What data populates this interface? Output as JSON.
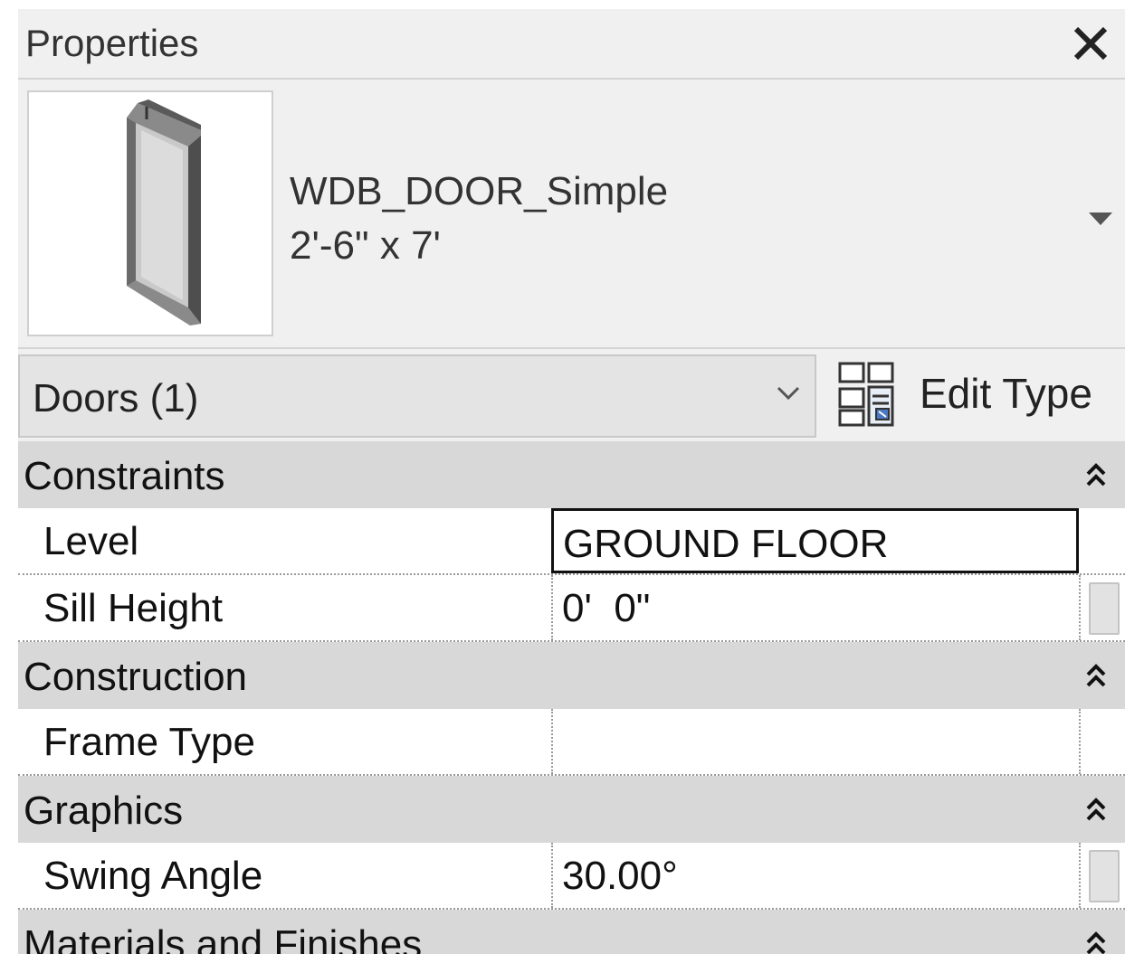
{
  "window": {
    "title": "Properties"
  },
  "type_selector": {
    "family": "WDB_DOOR_Simple",
    "type": "2'-6\" x 7'",
    "preview_icon": "door-preview-icon"
  },
  "filter": {
    "label": "Doors (1)"
  },
  "edit_type": {
    "label": "Edit Type"
  },
  "groups": [
    {
      "name": "Constraints",
      "rows": [
        {
          "name": "Level",
          "value": "GROUND FLOOR"
        },
        {
          "name": "Sill Height",
          "value": "0'  0\""
        }
      ]
    },
    {
      "name": "Construction",
      "rows": [
        {
          "name": "Frame Type",
          "value": ""
        }
      ]
    },
    {
      "name": "Graphics",
      "rows": [
        {
          "name": "Swing Angle",
          "value": "30.00°"
        }
      ]
    },
    {
      "name": "Materials and Finishes",
      "rows": []
    }
  ],
  "colors": {
    "panel_bg": "#f0f0f0",
    "group_bg": "#d8d8d8",
    "row_bg": "#ffffff"
  }
}
